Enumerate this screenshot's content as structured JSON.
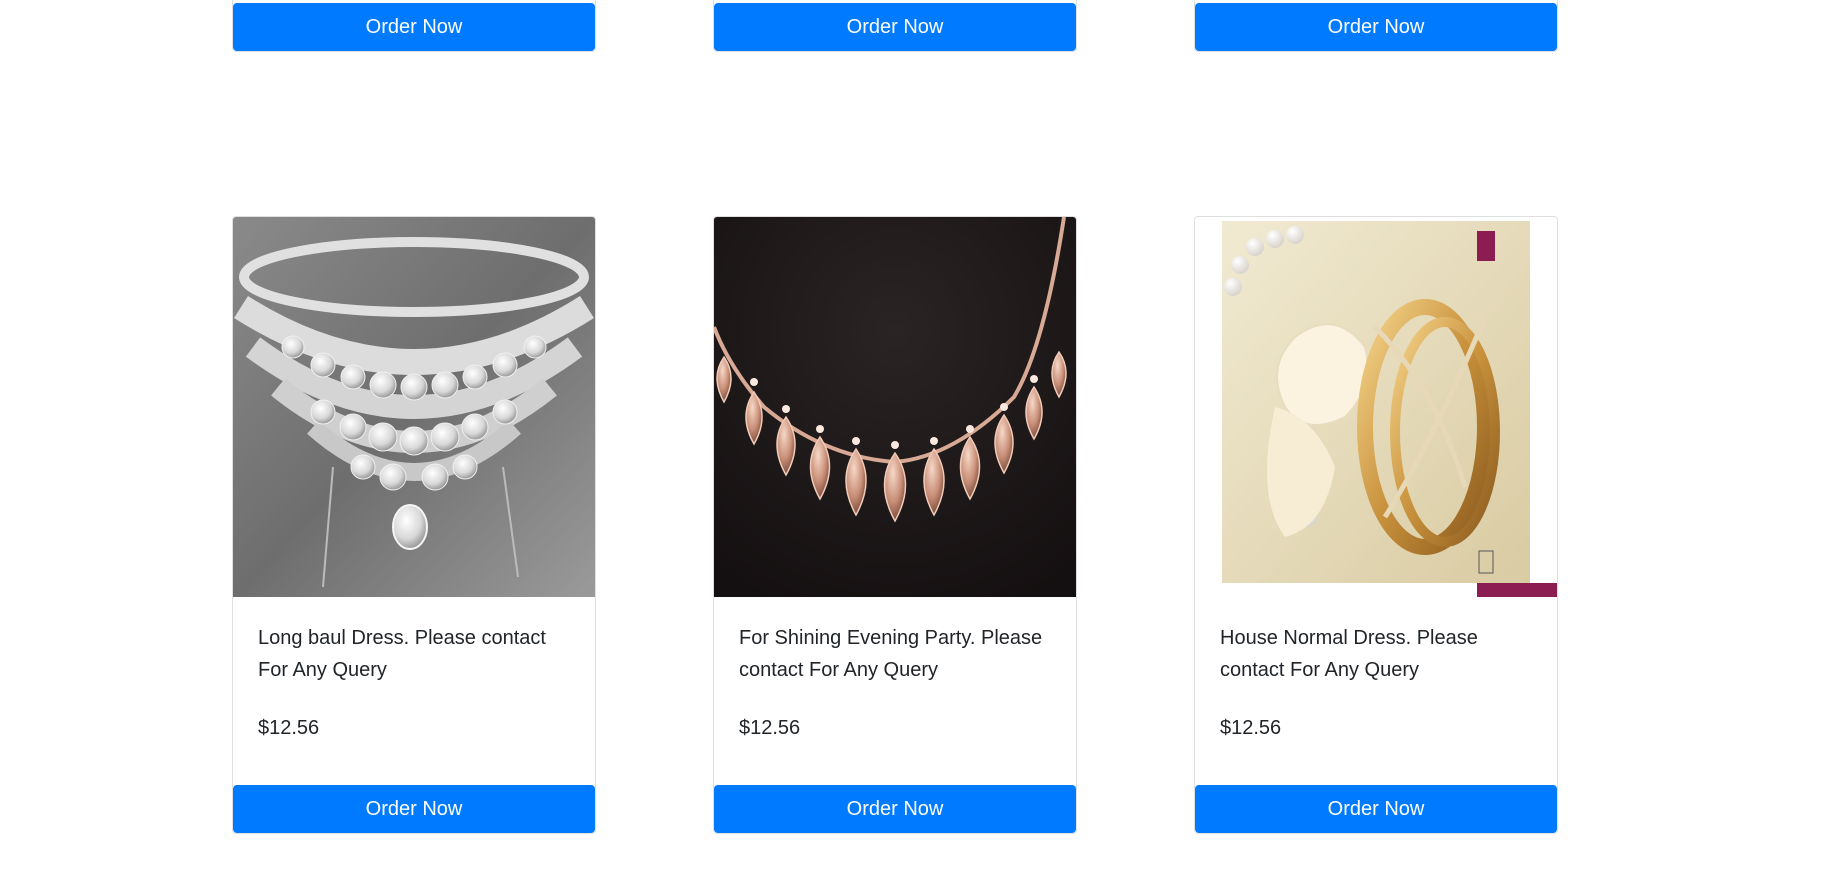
{
  "top_row": [
    {
      "button_label": "Order Now"
    },
    {
      "button_label": "Order Now"
    },
    {
      "button_label": "Order Now"
    }
  ],
  "products": [
    {
      "image": "silver-diamond-necklace",
      "description": "Long baul Dress. Please contact For Any Query",
      "price": "$12.56",
      "button_label": "Order Now"
    },
    {
      "image": "rose-gold-necklace",
      "description": "For Shining Evening Party. Please contact For Any Query",
      "price": "$12.56",
      "button_label": "Order Now"
    },
    {
      "image": "gold-diamond-ring",
      "description": "House Normal Dress. Please contact For Any Query",
      "price": "$12.56",
      "button_label": "Order Now"
    }
  ],
  "colors": {
    "button": "#007bff",
    "button_text": "#ffffff",
    "text": "#212529",
    "card_border": "#dfdfdf"
  }
}
